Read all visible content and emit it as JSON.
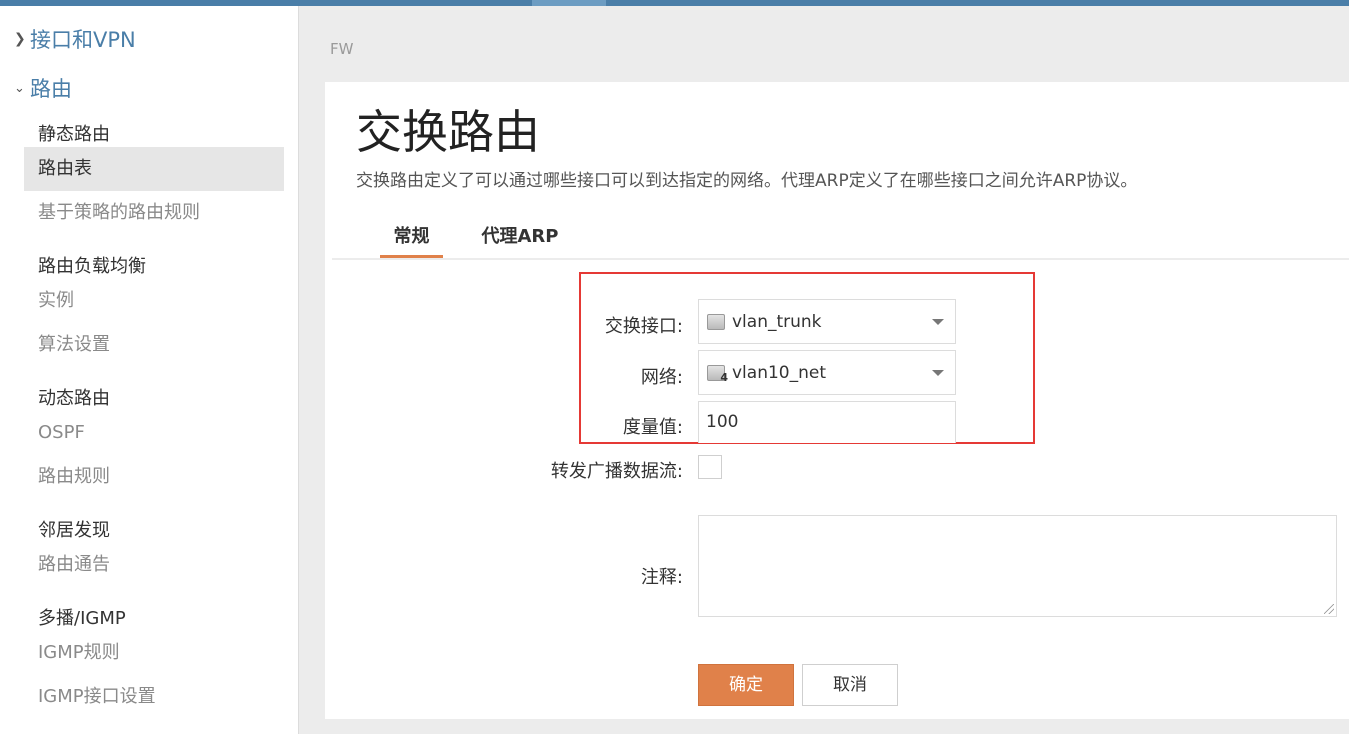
{
  "sidebar": {
    "group_interfaces": "接口和VPN",
    "group_routing": "路由",
    "static_routing": {
      "heading": "静态路由",
      "items": [
        "路由表",
        "基于策略的路由规则"
      ]
    },
    "load_balancing": {
      "heading": "路由负载均衡",
      "items": [
        "实例",
        "算法设置"
      ]
    },
    "dynamic_routing": {
      "heading": "动态路由",
      "items": [
        "OSPF",
        "路由规则"
      ]
    },
    "neighbor_discovery": {
      "heading": "邻居发现",
      "items": [
        "路由通告"
      ]
    },
    "multicast": {
      "heading": "多播/IGMP",
      "items": [
        "IGMP规则",
        "IGMP接口设置"
      ]
    }
  },
  "breadcrumb": "FW",
  "page": {
    "title": "交换路由",
    "description": "交换路由定义了可以通过哪些接口可以到达指定的网络。代理ARP定义了在哪些接口之间允许ARP协议。"
  },
  "tabs": [
    "常规",
    "代理ARP"
  ],
  "form": {
    "switched_interface": {
      "label": "交换接口:",
      "value": "vlan_trunk",
      "icon": "interface-icon"
    },
    "network": {
      "label": "网络:",
      "value": "vlan10_net",
      "icon": "network-object-icon",
      "badge": "4"
    },
    "metric": {
      "label": "度量值:",
      "value": "100"
    },
    "forward_broadcast": {
      "label": "转发广播数据流:",
      "checked": false
    },
    "comment": {
      "label": "注释:",
      "value": ""
    }
  },
  "buttons": {
    "ok": "确定",
    "cancel": "取消"
  },
  "colors": {
    "accent": "#e0814a",
    "link": "#4a7ea8",
    "highlight": "#e53935"
  }
}
